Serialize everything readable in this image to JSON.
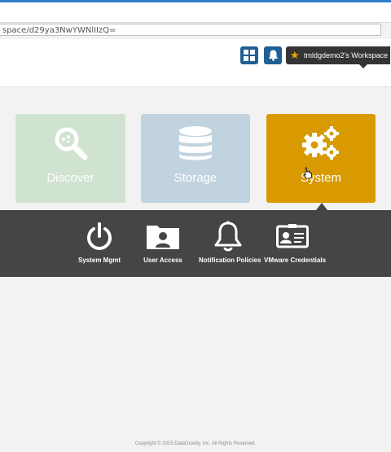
{
  "browser": {
    "url": "space/d29ya3NwYWNlIIzQ="
  },
  "header": {
    "grid_icon": "grid-icon",
    "bell_icon": "bell-icon",
    "workspace_label": "tmldgdemo2's Workspace",
    "workspace_icon": "star-icon"
  },
  "tiles": [
    {
      "label": "Discover",
      "icon": "search-icon",
      "color": "#d0e3d0"
    },
    {
      "label": "Storage",
      "icon": "database-icon",
      "color": "#c1d3df"
    },
    {
      "label": "System",
      "icon": "gears-icon",
      "color": "#d89a00"
    }
  ],
  "submenu": [
    {
      "label": "System Mgmt",
      "icon": "power-icon"
    },
    {
      "label": "User Access",
      "icon": "user-folder-icon"
    },
    {
      "label": "Notification Policies",
      "icon": "bell-icon"
    },
    {
      "label": "VMware Credentials",
      "icon": "id-card-icon"
    }
  ],
  "footer": {
    "copyright": "Copyright © 2015 DataGravity, Inc. All Rights Reserved."
  },
  "colors": {
    "header_button": "#1f5f94",
    "workspace_bg": "#343434",
    "panel_bg": "#454545",
    "accent_star": "#f0a500"
  }
}
